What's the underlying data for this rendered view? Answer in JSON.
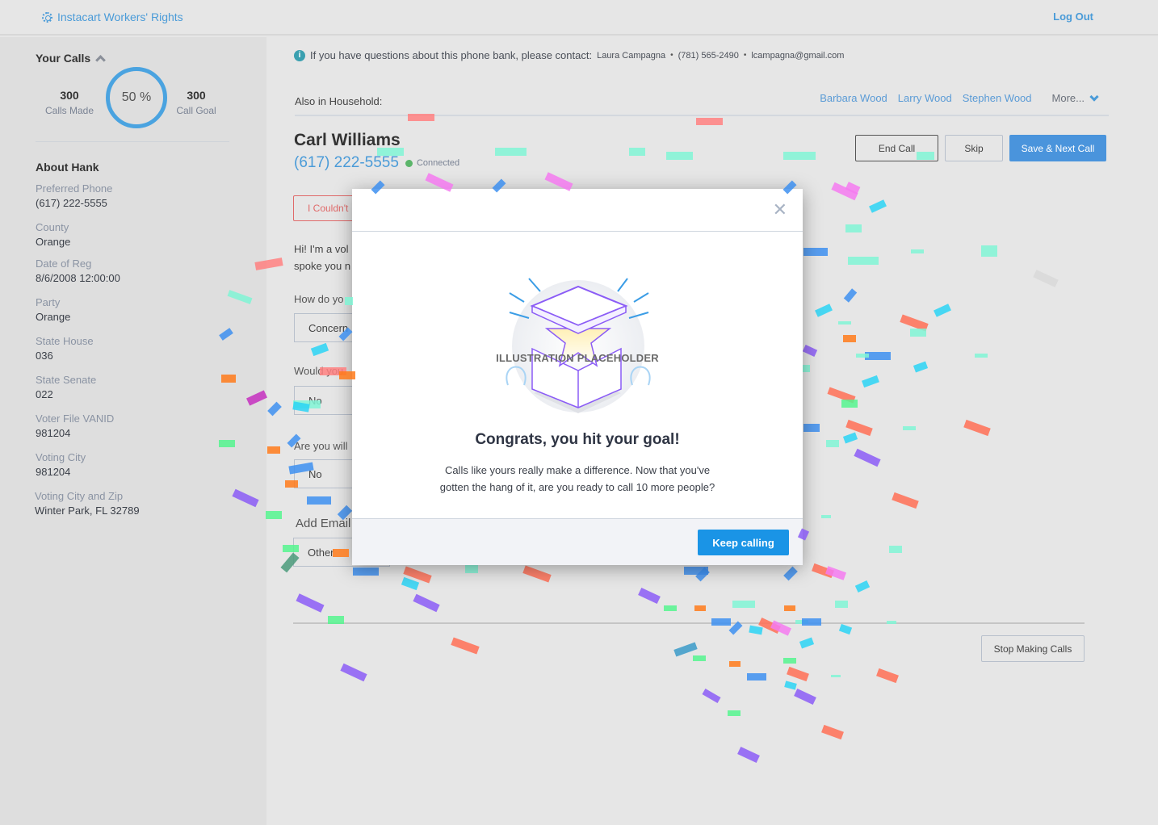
{
  "header": {
    "org_name": "Instacart Workers' Rights",
    "org_icon": "gear-icon",
    "logout_label": "Log Out"
  },
  "sidebar": {
    "your_calls_label": "Your Calls",
    "calls_made": {
      "value": "300",
      "label": "Calls Made"
    },
    "progress": {
      "percent": 50,
      "label": "50 %"
    },
    "call_goal": {
      "value": "300",
      "label": "Call Goal"
    },
    "about_title": "About Hank",
    "fields": [
      {
        "label": "Preferred Phone",
        "value": "(617) 222-5555"
      },
      {
        "label": "County",
        "value": "Orange"
      },
      {
        "label": "Date of Reg",
        "value": "8/6/2008 12:00:00"
      },
      {
        "label": "Party",
        "value": "Orange"
      },
      {
        "label": "State House",
        "value": "036"
      },
      {
        "label": "State Senate",
        "value": "022"
      },
      {
        "label": "Voter File VANID",
        "value": "981204"
      },
      {
        "label": "Voting City",
        "value": "981204"
      },
      {
        "label": "Voting City and Zip",
        "value": "Winter Park, FL 32789"
      }
    ]
  },
  "main": {
    "info_text": "If you have questions about this phone bank, please contact:",
    "contact_name": "Laura Campagna",
    "contact_phone": "(781) 565-2490",
    "contact_email": "lcampagna@gmail.com",
    "separator": "•",
    "household_label": "Also in Household:",
    "household_members": [
      "Barbara Wood",
      "Larry Wood",
      "Stephen Wood"
    ],
    "more_label": "More...",
    "contact_full_name": "Carl Williams",
    "contact_phone_number": "(617) 222-5555",
    "call_status": "Connected",
    "buttons": {
      "end_call": "End Call",
      "skip": "Skip",
      "save_next": "Save & Next Call",
      "couldnt": "I Couldn't",
      "stop": "Stop Making Calls"
    },
    "script_lines": [
      "Hi! I'm a vol",
      "spoke you n"
    ],
    "questions": [
      {
        "label": "How do yo",
        "answer": "Concern"
      },
      {
        "label": "Would you",
        "answer": "No"
      },
      {
        "label": "Are you will",
        "answer": "No"
      }
    ],
    "add_email_label": "Add Email",
    "email_type": "Other"
  },
  "modal": {
    "close_icon": "close-icon",
    "illustration_label": "ILLUSTRATION PLACEHOLDER",
    "title": "Congrats, you hit your goal!",
    "message_line1": "Calls like yours really make a difference. Now that you've",
    "message_line2": "gotten the hang of it, are you ready to call 10 more people?",
    "primary_button": "Keep calling"
  },
  "colors": {
    "accent": "#4a9bd8",
    "primary_button": "#1a94e6",
    "connected": "#5bb56a",
    "danger": "#e06a6a"
  }
}
